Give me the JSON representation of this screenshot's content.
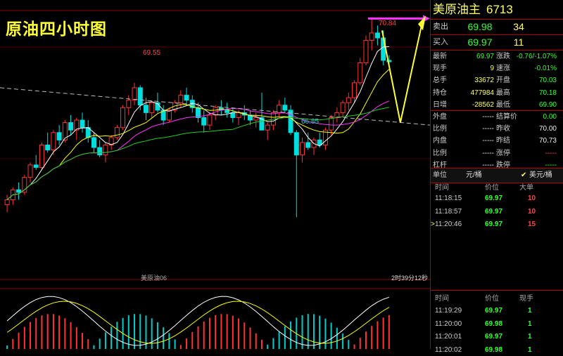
{
  "chart": {
    "title": "原油四小时图",
    "instrument_label": "美原油06",
    "countdown": "2时39分12秒",
    "labels": {
      "high": "70.84",
      "peak_left": "69.55",
      "low": "66.85"
    },
    "candles": [
      [
        67.1,
        67.3,
        66.95,
        67.2
      ],
      [
        67.2,
        67.45,
        67.1,
        67.4
      ],
      [
        67.4,
        67.55,
        67.2,
        67.35
      ],
      [
        67.35,
        67.7,
        67.3,
        67.65
      ],
      [
        67.65,
        67.95,
        67.55,
        67.9
      ],
      [
        67.9,
        68.1,
        67.8,
        67.85
      ],
      [
        67.85,
        68.35,
        67.8,
        68.3
      ],
      [
        68.3,
        68.55,
        68.15,
        68.2
      ],
      [
        68.2,
        68.6,
        68.1,
        68.55
      ],
      [
        68.55,
        68.7,
        68.3,
        68.4
      ],
      [
        68.4,
        68.8,
        68.35,
        68.75
      ],
      [
        68.75,
        68.9,
        68.5,
        68.6
      ],
      [
        68.6,
        68.85,
        68.4,
        68.8
      ],
      [
        68.8,
        68.95,
        68.55,
        68.65
      ],
      [
        68.65,
        68.8,
        68.35,
        68.45
      ],
      [
        68.45,
        68.55,
        68.15,
        68.25
      ],
      [
        68.25,
        68.4,
        68.05,
        68.1
      ],
      [
        68.1,
        68.35,
        67.95,
        68.3
      ],
      [
        68.3,
        68.5,
        68.2,
        68.45
      ],
      [
        68.45,
        68.7,
        68.4,
        68.65
      ],
      [
        68.65,
        69.1,
        68.6,
        69.05
      ],
      [
        69.05,
        69.3,
        68.9,
        69.2
      ],
      [
        69.2,
        69.55,
        69.1,
        69.45
      ],
      [
        69.45,
        69.5,
        69.0,
        69.1
      ],
      [
        69.1,
        69.25,
        68.8,
        68.95
      ],
      [
        68.95,
        69.2,
        68.85,
        69.15
      ],
      [
        69.15,
        69.35,
        68.95,
        69.0
      ],
      [
        69.0,
        69.1,
        68.7,
        68.8
      ],
      [
        68.8,
        69.05,
        68.75,
        69.0
      ],
      [
        69.0,
        69.2,
        68.95,
        69.15
      ],
      [
        69.15,
        69.4,
        69.05,
        69.3
      ],
      [
        69.3,
        69.45,
        69.1,
        69.2
      ],
      [
        69.2,
        69.3,
        68.95,
        69.05
      ],
      [
        69.05,
        69.15,
        68.75,
        68.85
      ],
      [
        68.85,
        69.0,
        68.55,
        68.7
      ],
      [
        68.7,
        68.95,
        68.6,
        68.9
      ],
      [
        68.9,
        69.1,
        68.8,
        69.05
      ],
      [
        69.05,
        69.2,
        68.9,
        69.0
      ],
      [
        69.0,
        69.15,
        68.85,
        68.95
      ],
      [
        68.95,
        69.05,
        68.75,
        68.85
      ],
      [
        68.85,
        69.0,
        68.7,
        68.95
      ],
      [
        68.95,
        69.1,
        68.8,
        68.9
      ],
      [
        68.9,
        69.0,
        68.7,
        68.8
      ],
      [
        68.8,
        68.95,
        68.65,
        68.85
      ],
      [
        68.85,
        69.35,
        68.8,
        68.6
      ],
      [
        68.6,
        68.75,
        68.4,
        68.7
      ],
      [
        68.7,
        69.0,
        68.6,
        68.95
      ],
      [
        68.95,
        69.2,
        68.85,
        69.1
      ],
      [
        69.1,
        69.25,
        68.95,
        69.0
      ],
      [
        69.0,
        69.1,
        68.5,
        68.55
      ],
      [
        68.55,
        68.6,
        66.85,
        68.1
      ],
      [
        68.1,
        68.45,
        67.95,
        68.35
      ],
      [
        68.35,
        68.55,
        68.2,
        68.25
      ],
      [
        68.25,
        68.45,
        68.1,
        68.4
      ],
      [
        68.4,
        68.55,
        68.25,
        68.3
      ],
      [
        68.3,
        68.65,
        68.2,
        68.6
      ],
      [
        68.6,
        68.9,
        68.5,
        68.85
      ],
      [
        68.85,
        69.05,
        68.75,
        68.95
      ],
      [
        68.95,
        69.2,
        68.85,
        69.15
      ],
      [
        69.15,
        69.35,
        69.0,
        69.25
      ],
      [
        69.25,
        69.6,
        69.15,
        69.55
      ],
      [
        69.55,
        70.05,
        69.5,
        69.95
      ],
      [
        69.95,
        70.5,
        69.9,
        70.4
      ],
      [
        70.4,
        70.84,
        70.2,
        70.55
      ],
      [
        70.55,
        70.7,
        70.3,
        70.45
      ],
      [
        70.45,
        70.6,
        69.9,
        70.0
      ],
      [
        70.0,
        70.1,
        69.85,
        69.97
      ]
    ]
  },
  "panel": {
    "header": {
      "name": "美原油主",
      "code": "6713"
    },
    "sell": {
      "label": "卖出",
      "price": "69.98",
      "volume": "34"
    },
    "buy": {
      "label": "买入",
      "price": "69.97",
      "volume": "11"
    },
    "stats": [
      {
        "l1": "最新",
        "v1": "69.97",
        "c1": "g",
        "l2": "涨跌",
        "v2": "-0.76/-1.07%",
        "c2": "g"
      },
      {
        "l1": "现手",
        "v1": "9",
        "c1": "y",
        "l2": "速涨",
        "v2": "-0.01%",
        "c2": "g"
      },
      {
        "l1": "总手",
        "v1": "33672",
        "c1": "y",
        "l2": "开盘",
        "v2": "70.03",
        "c2": "g"
      },
      {
        "l1": "持仓",
        "v1": "477984",
        "c1": "y",
        "l2": "最高",
        "v2": "70.18",
        "c2": "g"
      },
      {
        "l1": "日增",
        "v1": "-28562",
        "c1": "y",
        "l2": "最低",
        "v2": "69.90",
        "c2": "g"
      },
      {
        "l1": "外盘",
        "v1": "-----",
        "c1": "w",
        "l2": "结算价",
        "v2": "0.00",
        "c2": "g"
      },
      {
        "l1": "比例",
        "v1": "-----",
        "c1": "w",
        "l2": "昨收",
        "v2": "70.00",
        "c2": "w"
      },
      {
        "l1": "内盘",
        "v1": "-----",
        "c1": "w",
        "l2": "昨结",
        "v2": "70.73",
        "c2": "w"
      },
      {
        "l1": "比例",
        "v1": "-----",
        "c1": "w",
        "l2": "涨停",
        "v2": "-----",
        "c2": "r"
      },
      {
        "l1": "杠杆",
        "v1": "-----",
        "c1": "w",
        "l2": "跌停",
        "v2": "-----",
        "c2": "g"
      }
    ],
    "unit": {
      "label": "单位",
      "value": "元/桶",
      "option": "美元/桶"
    },
    "ticks_top": {
      "headers": {
        "time": "时间",
        "price": "价位",
        "size": "大单"
      },
      "rows": [
        {
          "time": "11:18:15",
          "price": "69.97",
          "vol": "10"
        },
        {
          "time": "11:18:57",
          "price": "69.97",
          "vol": "10"
        },
        {
          "time": "11:20:46",
          "price": "69.97",
          "vol": "15"
        }
      ]
    },
    "ticks_bottom": {
      "headers": {
        "time": "时间",
        "price": "价位",
        "size": "现手"
      },
      "rows": [
        {
          "time": "11:19:29",
          "price": "69.97",
          "vol": "1"
        },
        {
          "time": "11:20:00",
          "price": "69.98",
          "vol": "1"
        },
        {
          "time": "11:20:01",
          "price": "69.97",
          "vol": "1"
        },
        {
          "time": "11:20:02",
          "price": "69.98",
          "vol": "1"
        }
      ]
    }
  }
}
